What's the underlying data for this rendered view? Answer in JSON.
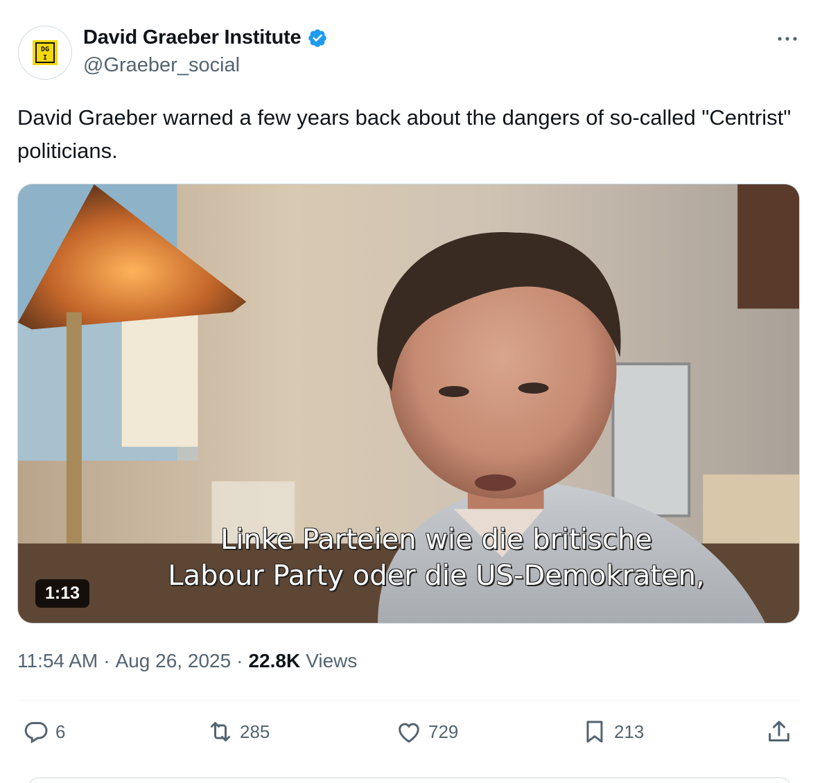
{
  "author": {
    "display_name": "David Graeber Institute",
    "handle": "@Graeber_social",
    "avatar_logo_text": "DG I",
    "verified": true
  },
  "tweet": {
    "text": "David Graeber warned a few years back about the dangers of so-called \"Centrist\" politicians."
  },
  "media": {
    "subtitle_line1": "Linke Parteien wie die britische",
    "subtitle_line2": "Labour Party oder die US-Demokraten,",
    "duration": "1:13"
  },
  "meta": {
    "time": "11:54 AM",
    "separator": "·",
    "date": "Aug 26, 2025",
    "views_count": "22.8K",
    "views_label": "Views"
  },
  "actions": {
    "replies": "6",
    "reposts": "285",
    "likes": "729",
    "bookmarks": "213"
  },
  "colors": {
    "text_primary": "#0f1419",
    "text_secondary": "#536471",
    "verified_blue": "#1d9bf0",
    "logo_yellow": "#f5d90a"
  }
}
